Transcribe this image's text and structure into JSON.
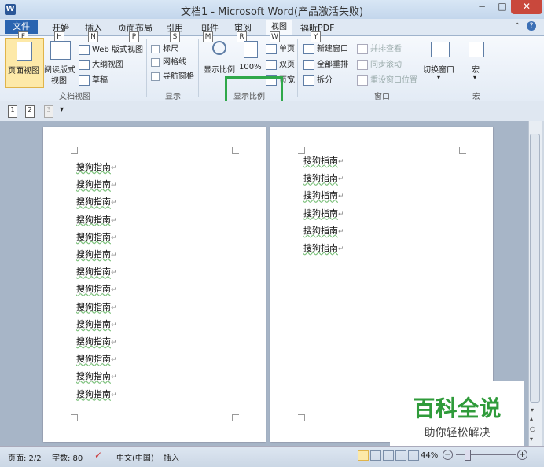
{
  "window": {
    "title": "文档1 - Microsoft Word(产品激活失败)",
    "app_icon": "W",
    "controls": [
      "−",
      "□",
      "✕"
    ]
  },
  "tabs": [
    {
      "label": "文件",
      "key": "F"
    },
    {
      "label": "开始",
      "key": "H"
    },
    {
      "label": "插入",
      "key": "N"
    },
    {
      "label": "页面布局",
      "key": "P"
    },
    {
      "label": "引用",
      "key": "S"
    },
    {
      "label": "邮件",
      "key": "M"
    },
    {
      "label": "审阅",
      "key": "R"
    },
    {
      "label": "视图",
      "key": "W"
    },
    {
      "label": "福昕PDF",
      "key": "Y"
    }
  ],
  "ribbon": {
    "doc_views": {
      "label": "文档视图",
      "page_view": "页面视图",
      "reading_view_1": "阅读版式",
      "reading_view_2": "视图",
      "web_view": "Web 版式视图",
      "outline": "大纲视图",
      "draft": "草稿"
    },
    "show": {
      "label": "显示",
      "ruler": "标尺",
      "gridlines": "网格线",
      "nav_pane": "导航窗格"
    },
    "zoom": {
      "label": "显示比例",
      "zoom": "显示比例",
      "hundred": "100%",
      "one_page": "单页",
      "two_pages": "双页",
      "page_width": "页宽"
    },
    "window": {
      "label": "窗口",
      "new_window": "新建窗口",
      "arrange_all": "全部重排",
      "split": "拆分",
      "side_by_side": "并排查看",
      "sync_scroll": "同步滚动",
      "reset_position": "重设窗口位置",
      "switch_windows": "切换窗口"
    },
    "macros": {
      "label": "宏",
      "macros": "宏"
    }
  },
  "document": {
    "page1_lines": [
      "搜狗指南",
      "搜狗指南",
      "搜狗指南",
      "搜狗指南",
      "搜狗指南",
      "搜狗指南",
      "搜狗指南",
      "搜狗指南",
      "搜狗指南",
      "搜狗指南",
      "搜狗指南",
      "搜狗指南",
      "搜狗指南",
      "搜狗指南"
    ],
    "page2_lines": [
      "搜狗指南",
      "搜狗指南",
      "搜狗指南",
      "搜狗指南",
      "搜狗指南",
      "搜狗指南"
    ],
    "paragraph_mark": "↵"
  },
  "statusbar": {
    "page": "页面: 2/2",
    "words": "字数: 80",
    "language": "中文(中国)",
    "mode": "插入",
    "zoom": "44%"
  },
  "watermark": {
    "title": "百科全说",
    "subtitle": "助你轻松解决"
  },
  "colors": {
    "accent": "#2a64b0",
    "highlight": "#2fa84a",
    "watermark": "#2f9b3a"
  }
}
